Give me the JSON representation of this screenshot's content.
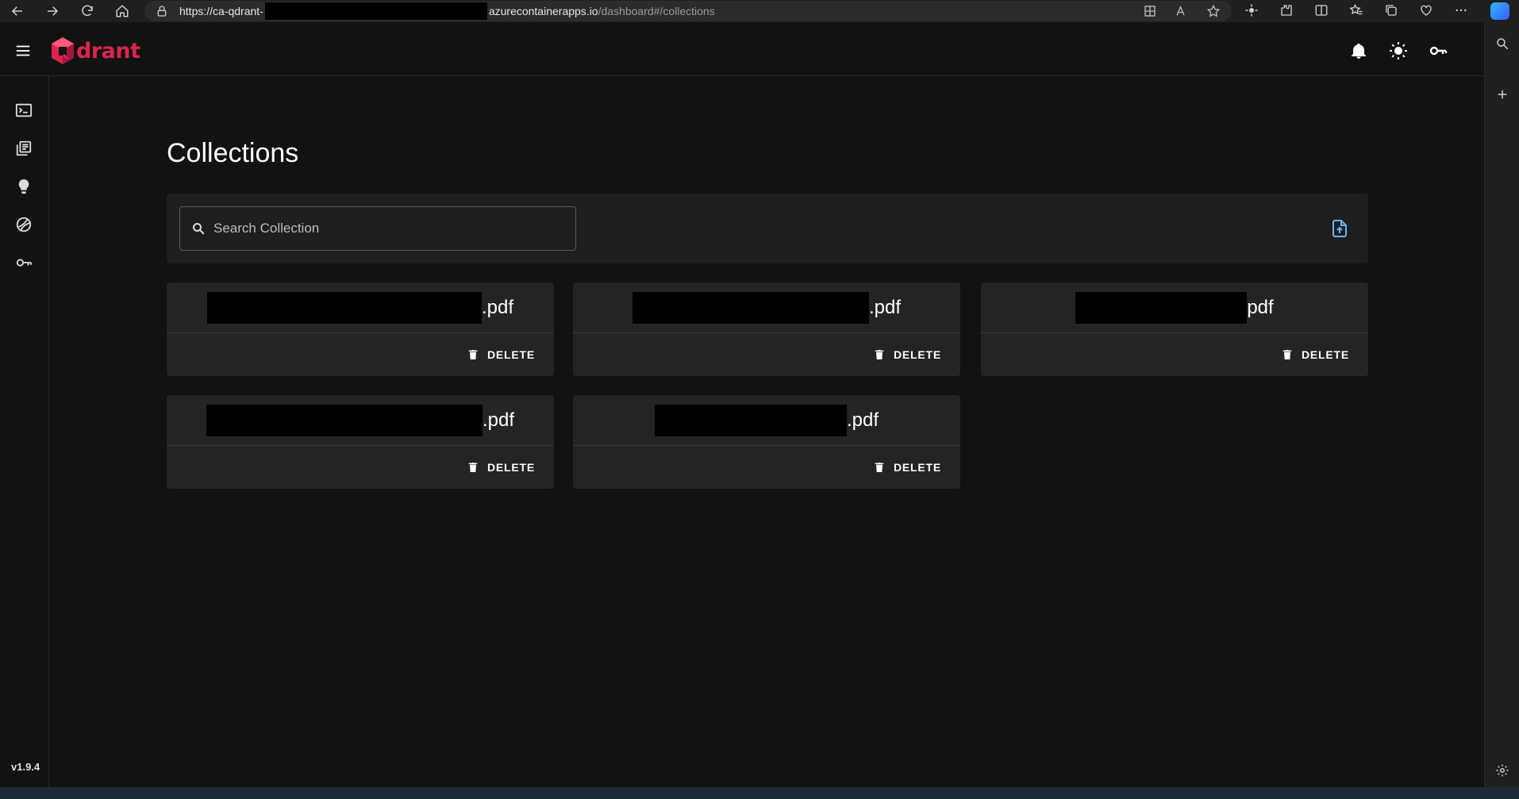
{
  "browser": {
    "url_prefix": "https://ca-qdrant-",
    "url_domain": "azurecontainerapps.io",
    "url_path": "/dashboard#/collections"
  },
  "app": {
    "logo_text": "drant",
    "version": "v1.9.4"
  },
  "page": {
    "title": "Collections"
  },
  "search": {
    "placeholder": "Search Collection",
    "value": ""
  },
  "collections": [
    {
      "name_suffix": ".pdf",
      "delete_label": "DELETE"
    },
    {
      "name_suffix": ".pdf",
      "delete_label": "DELETE"
    },
    {
      "name_suffix": "pdf",
      "delete_label": "DELETE"
    },
    {
      "name_suffix": ".pdf",
      "delete_label": "DELETE"
    },
    {
      "name_suffix": ".pdf",
      "delete_label": "DELETE"
    }
  ],
  "colors": {
    "brand": "#dc244c",
    "background": "#121212",
    "card": "#242424",
    "accent": "#64b5f6"
  }
}
